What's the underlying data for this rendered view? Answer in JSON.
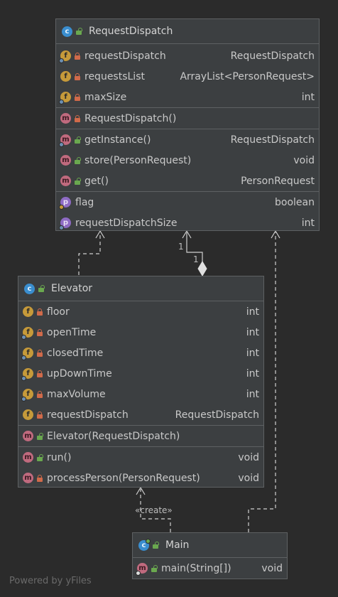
{
  "classes": {
    "request_dispatch": {
      "name": "RequestDispatch",
      "fields": [
        {
          "name": "requestDispatch",
          "type": "RequestDispatch",
          "badge": "f",
          "access": "private"
        },
        {
          "name": "requestsList",
          "type": "ArrayList<PersonRequest>",
          "badge": "f",
          "access": "private"
        },
        {
          "name": "maxSize",
          "type": "int",
          "badge": "f",
          "access": "private"
        }
      ],
      "constructors": [
        {
          "name": "RequestDispatch()",
          "type": "",
          "badge": "m",
          "access": "private"
        }
      ],
      "methods": [
        {
          "name": "getInstance()",
          "type": "RequestDispatch",
          "badge": "m",
          "access": "public"
        },
        {
          "name": "store(PersonRequest)",
          "type": "void",
          "badge": "m",
          "access": "public"
        },
        {
          "name": "get()",
          "type": "PersonRequest",
          "badge": "m",
          "access": "public"
        }
      ],
      "properties": [
        {
          "name": "flag",
          "type": "boolean",
          "badge": "p"
        },
        {
          "name": "requestDispatchSize",
          "type": "int",
          "badge": "p"
        }
      ]
    },
    "elevator": {
      "name": "Elevator",
      "fields": [
        {
          "name": "floor",
          "type": "int",
          "badge": "f",
          "access": "private"
        },
        {
          "name": "openTime",
          "type": "int",
          "badge": "f",
          "access": "private"
        },
        {
          "name": "closedTime",
          "type": "int",
          "badge": "f",
          "access": "private"
        },
        {
          "name": "upDownTime",
          "type": "int",
          "badge": "f",
          "access": "private"
        },
        {
          "name": "maxVolume",
          "type": "int",
          "badge": "f",
          "access": "private"
        },
        {
          "name": "requestDispatch",
          "type": "RequestDispatch",
          "badge": "f",
          "access": "private"
        }
      ],
      "constructors": [
        {
          "name": "Elevator(RequestDispatch)",
          "type": "",
          "badge": "m",
          "access": "public"
        }
      ],
      "methods": [
        {
          "name": "run()",
          "type": "void",
          "badge": "m",
          "access": "public"
        },
        {
          "name": "processPerson(PersonRequest)",
          "type": "void",
          "badge": "m",
          "access": "private"
        }
      ]
    },
    "main": {
      "name": "Main",
      "methods": [
        {
          "name": "main(String[])",
          "type": "void",
          "badge": "m",
          "access": "public"
        }
      ]
    }
  },
  "edges": {
    "multiplicity_source": "1",
    "multiplicity_target": "1",
    "create_label": "«create»"
  },
  "footer": "Powered by yFiles",
  "colors": {
    "background": "#2b2b2b",
    "box": "#3c3f41",
    "border": "#5e6163",
    "class_badge": "#3a8ecf",
    "field_badge": "#c69a3a",
    "method_badge": "#c06a7e",
    "property_badge": "#8e6bc4"
  }
}
